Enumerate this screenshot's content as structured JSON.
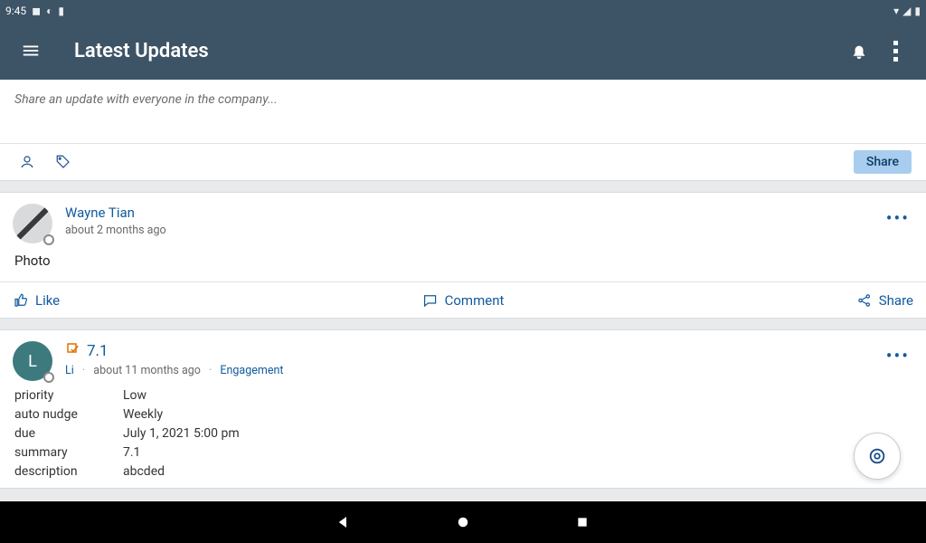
{
  "statusbar": {
    "time": "9:45"
  },
  "appbar": {
    "title": "Latest Updates"
  },
  "composer": {
    "placeholder": "Share an update with everyone in the company...",
    "share_label": "Share"
  },
  "posts": [
    {
      "author": "Wayne Tian",
      "time": "about 2 months ago",
      "body": "Photo",
      "actions": {
        "like": "Like",
        "comment": "Comment",
        "share": "Share"
      }
    },
    {
      "avatar_letter": "L",
      "title": "7.1",
      "author": "Li",
      "time": "about 11 months ago",
      "category": "Engagement",
      "kv": [
        {
          "k": "priority",
          "v": "Low"
        },
        {
          "k": "auto nudge",
          "v": "Weekly"
        },
        {
          "k": "due",
          "v": "July 1, 2021 5:00 pm"
        },
        {
          "k": "summary",
          "v": "7.1"
        },
        {
          "k": "description",
          "v": "abcded"
        }
      ]
    }
  ]
}
